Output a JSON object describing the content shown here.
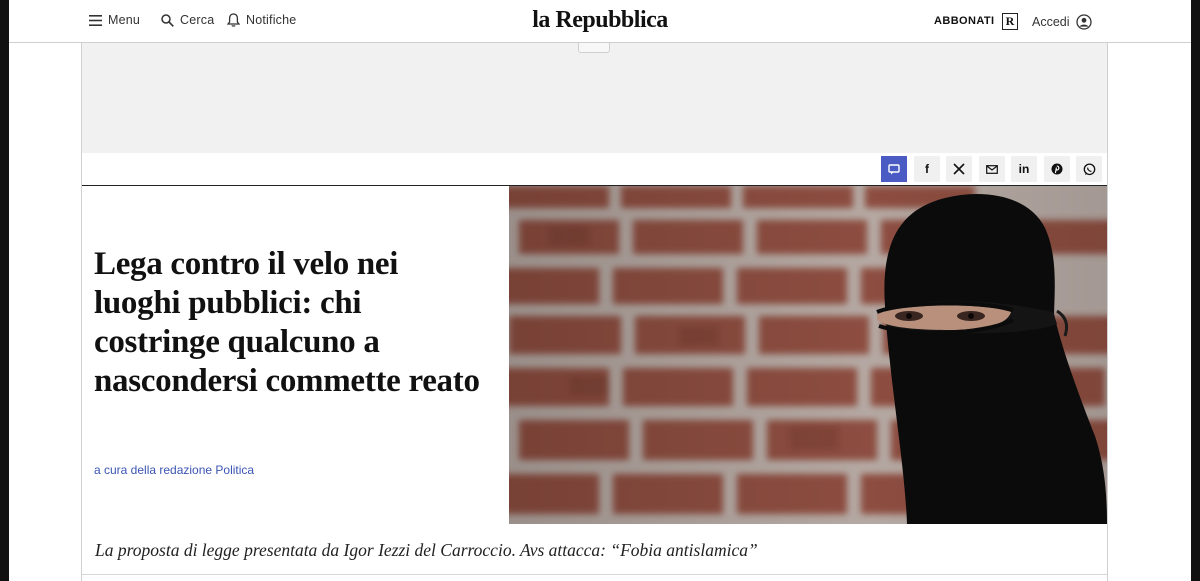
{
  "header": {
    "menu_label": "Menu",
    "search_label": "Cerca",
    "notifications_label": "Notifiche",
    "logo_text": "la Repubblica",
    "subscribe_label": "ABBONATI",
    "r_badge": "R",
    "login_label": "Accedi"
  },
  "share": {
    "buttons": [
      {
        "icon": "comment-icon",
        "label": ""
      },
      {
        "icon": "facebook-icon",
        "label": "f"
      },
      {
        "icon": "x-icon",
        "label": "𝕏"
      },
      {
        "icon": "mail-icon",
        "label": ""
      },
      {
        "icon": "linkedin-icon",
        "label": "in"
      },
      {
        "icon": "pinterest-icon",
        "label": ""
      },
      {
        "icon": "whatsapp-icon",
        "label": ""
      }
    ]
  },
  "article": {
    "headline": "Lega contro il velo nei luoghi pubblici: chi costringe qualcuno a nascondersi commette reato",
    "byline": "a cura della redazione Politica",
    "subtitle": "La proposta di legge presentata da Igor Iezzi del Carroccio. Avs attacca: “Fobia antislamica”"
  },
  "colors": {
    "accent": "#4a5bc4",
    "byline": "#3b55b3"
  }
}
